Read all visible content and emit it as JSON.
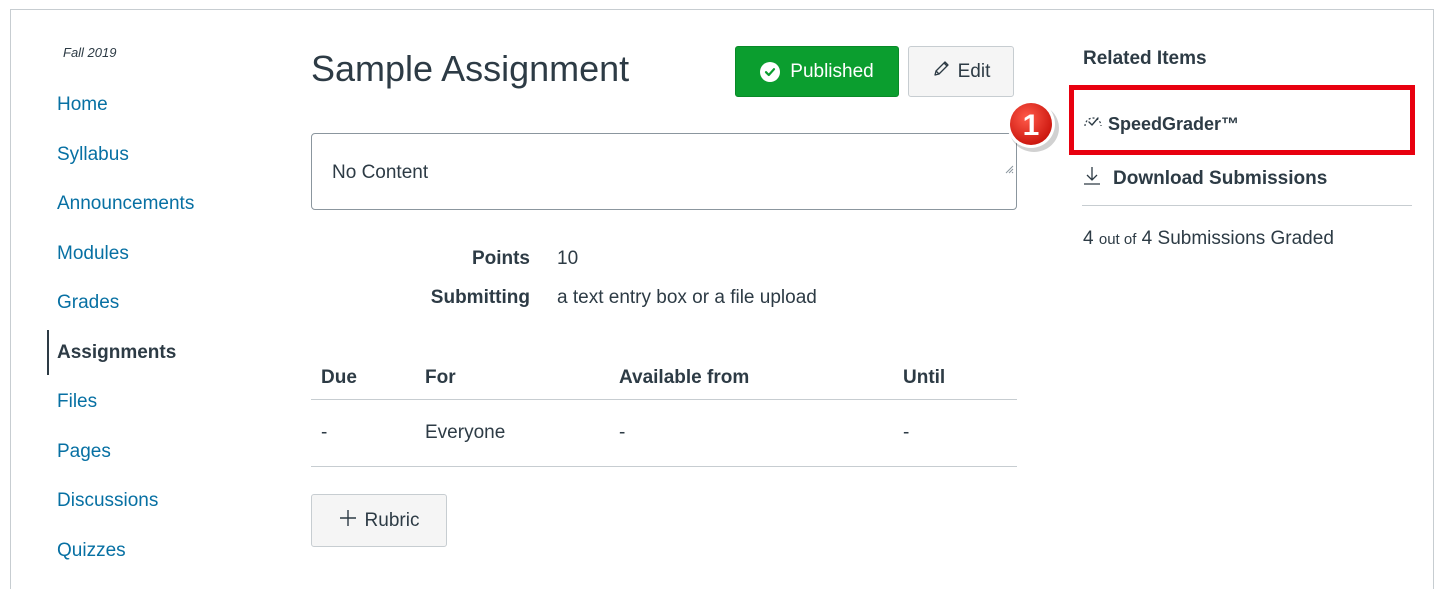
{
  "course": {
    "term": "Fall 2019"
  },
  "nav": {
    "items": [
      {
        "label": "Home"
      },
      {
        "label": "Syllabus"
      },
      {
        "label": "Announcements"
      },
      {
        "label": "Modules"
      },
      {
        "label": "Grades"
      },
      {
        "label": "Assignments",
        "active": true
      },
      {
        "label": "Files"
      },
      {
        "label": "Pages"
      },
      {
        "label": "Discussions"
      },
      {
        "label": "Quizzes"
      }
    ]
  },
  "assignment": {
    "title": "Sample Assignment",
    "published_label": "Published",
    "edit_label": "Edit",
    "description": "No Content",
    "points_label": "Points",
    "points_value": "10",
    "submitting_label": "Submitting",
    "submitting_value": "a text entry box or a file upload",
    "dates": {
      "headers": [
        "Due",
        "For",
        "Available from",
        "Until"
      ],
      "rows": [
        [
          "-",
          "Everyone",
          "-",
          "-"
        ]
      ]
    },
    "rubric_label": "Rubric"
  },
  "sidebar": {
    "title": "Related Items",
    "speedgrader_label": "SpeedGrader™",
    "download_label": "Download Submissions",
    "graded_prefix": "4",
    "graded_small": "out of",
    "graded_suffix": "4 Submissions Graded"
  },
  "annotation": {
    "step_number": "1"
  },
  "colors": {
    "link": "#0770a3",
    "published": "#0b9e2f",
    "highlight": "#e8000f",
    "text": "#2d3b45"
  },
  "icons": {
    "published": "check-circle-icon",
    "edit": "pencil-icon",
    "rubric": "plus-icon",
    "speedgrader": "speedgrader-icon",
    "download": "download-icon"
  }
}
